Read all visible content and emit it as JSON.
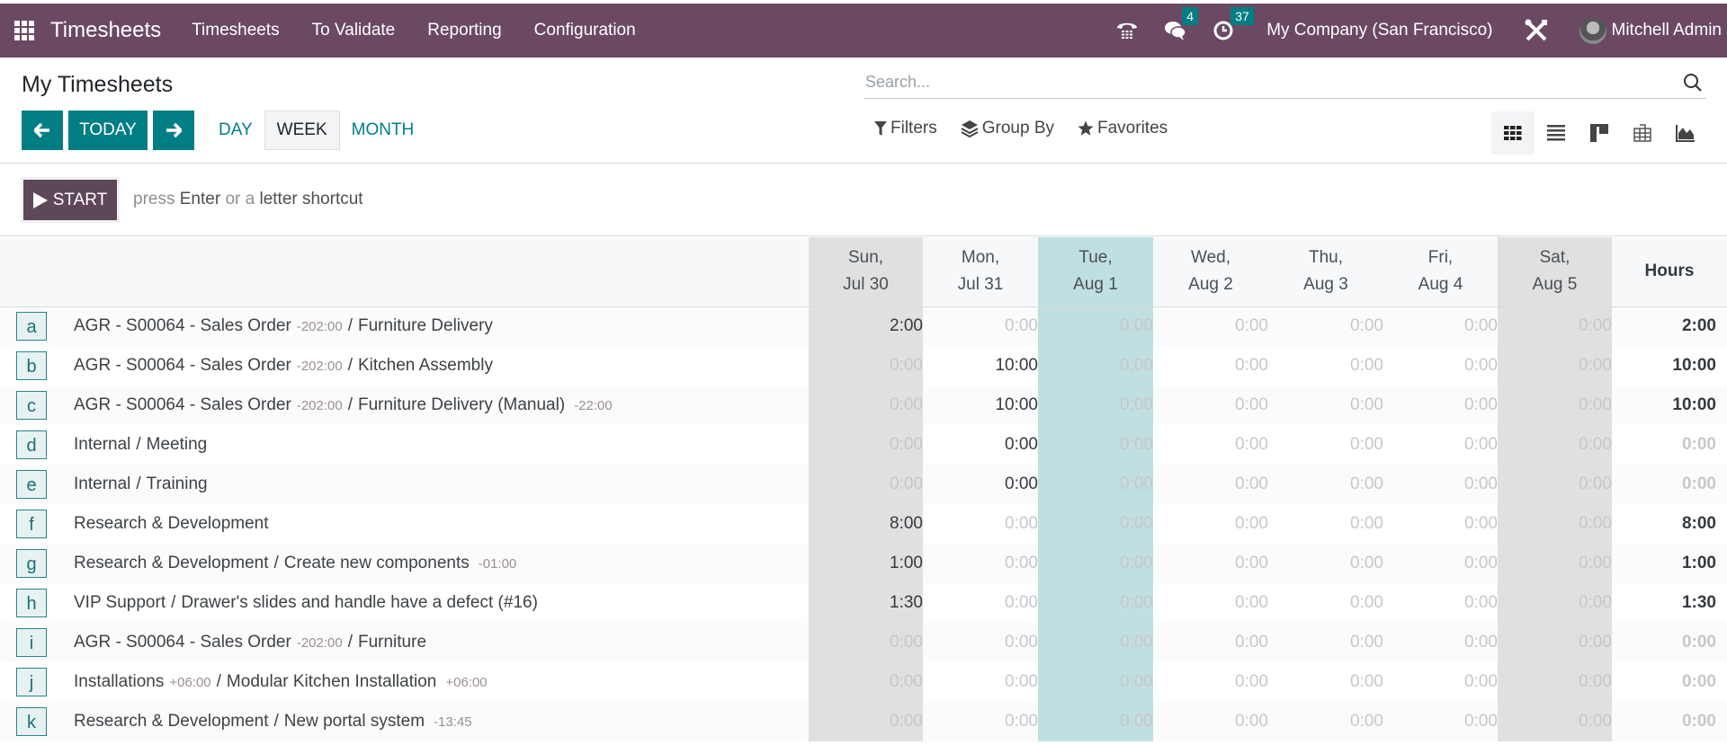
{
  "navbar": {
    "app_name": "Timesheets",
    "menu": [
      "Timesheets",
      "To Validate",
      "Reporting",
      "Configuration"
    ],
    "messages_count": "4",
    "activities_count": "37",
    "company": "My Company (San Francisco)",
    "user": "Mitchell Admin"
  },
  "control_panel": {
    "title": "My Timesheets",
    "today_label": "TODAY",
    "scales": [
      "DAY",
      "WEEK",
      "MONTH"
    ],
    "active_scale": "WEEK",
    "search_placeholder": "Search...",
    "filters_label": "Filters",
    "groupby_label": "Group By",
    "favorites_label": "Favorites",
    "views": [
      "grid-view",
      "list-view",
      "kanban-view",
      "pivot-view",
      "graph-view"
    ],
    "active_view": "grid-view"
  },
  "start_bar": {
    "start_label": "START",
    "hint_press": "press",
    "hint_enter": "Enter",
    "hint_or": "or a",
    "hint_shortcut": "letter shortcut"
  },
  "colors": {
    "navbar": "#6b4963",
    "primary": "#017e84",
    "start_button": "#5e4758",
    "today_column": "#c0dfe0",
    "weekend_column": "#e0e0e0"
  },
  "grid": {
    "days": [
      {
        "day": "Sun,",
        "date": "Jul 30",
        "type": "weekend"
      },
      {
        "day": "Mon,",
        "date": "Jul 31",
        "type": "normal"
      },
      {
        "day": "Tue,",
        "date": "Aug 1",
        "type": "today"
      },
      {
        "day": "Wed,",
        "date": "Aug 2",
        "type": "normal"
      },
      {
        "day": "Thu,",
        "date": "Aug 3",
        "type": "normal"
      },
      {
        "day": "Fri,",
        "date": "Aug 4",
        "type": "normal"
      },
      {
        "day": "Sat,",
        "date": "Aug 5",
        "type": "weekend"
      }
    ],
    "total_header": "Hours",
    "rows": [
      {
        "key": "a",
        "project": "AGR - S00064 - Sales Order",
        "project_remaining": "-202:00",
        "task": "Furniture Delivery",
        "task_remaining": "",
        "values": [
          "2:00",
          "0:00",
          "0:00",
          "0:00",
          "0:00",
          "0:00",
          "0:00"
        ],
        "set": [
          true,
          false,
          false,
          false,
          false,
          false,
          false
        ],
        "total": "2:00"
      },
      {
        "key": "b",
        "project": "AGR - S00064 - Sales Order",
        "project_remaining": "-202:00",
        "task": "Kitchen Assembly",
        "task_remaining": "",
        "values": [
          "0:00",
          "10:00",
          "0:00",
          "0:00",
          "0:00",
          "0:00",
          "0:00"
        ],
        "set": [
          false,
          true,
          false,
          false,
          false,
          false,
          false
        ],
        "total": "10:00"
      },
      {
        "key": "c",
        "project": "AGR - S00064 - Sales Order",
        "project_remaining": "-202:00",
        "task": "Furniture Delivery (Manual)",
        "task_remaining": "-22:00",
        "values": [
          "0:00",
          "10:00",
          "0:00",
          "0:00",
          "0:00",
          "0:00",
          "0:00"
        ],
        "set": [
          false,
          true,
          false,
          false,
          false,
          false,
          false
        ],
        "total": "10:00"
      },
      {
        "key": "d",
        "project": "Internal",
        "project_remaining": "",
        "task": "Meeting",
        "task_remaining": "",
        "values": [
          "0:00",
          "0:00",
          "0:00",
          "0:00",
          "0:00",
          "0:00",
          "0:00"
        ],
        "set": [
          false,
          true,
          false,
          false,
          false,
          false,
          false
        ],
        "total": "0:00"
      },
      {
        "key": "e",
        "project": "Internal",
        "project_remaining": "",
        "task": "Training",
        "task_remaining": "",
        "values": [
          "0:00",
          "0:00",
          "0:00",
          "0:00",
          "0:00",
          "0:00",
          "0:00"
        ],
        "set": [
          false,
          true,
          false,
          false,
          false,
          false,
          false
        ],
        "total": "0:00"
      },
      {
        "key": "f",
        "project": "Research & Development",
        "project_remaining": "",
        "task": "",
        "task_remaining": "",
        "values": [
          "8:00",
          "0:00",
          "0:00",
          "0:00",
          "0:00",
          "0:00",
          "0:00"
        ],
        "set": [
          true,
          false,
          false,
          false,
          false,
          false,
          false
        ],
        "total": "8:00"
      },
      {
        "key": "g",
        "project": "Research & Development",
        "project_remaining": "",
        "task": "Create new components",
        "task_remaining": "-01:00",
        "values": [
          "1:00",
          "0:00",
          "0:00",
          "0:00",
          "0:00",
          "0:00",
          "0:00"
        ],
        "set": [
          true,
          false,
          false,
          false,
          false,
          false,
          false
        ],
        "total": "1:00"
      },
      {
        "key": "h",
        "project": "VIP Support",
        "project_remaining": "",
        "task": "Drawer's slides and handle have a defect (#16)",
        "task_remaining": "",
        "values": [
          "1:30",
          "0:00",
          "0:00",
          "0:00",
          "0:00",
          "0:00",
          "0:00"
        ],
        "set": [
          true,
          false,
          false,
          false,
          false,
          false,
          false
        ],
        "total": "1:30"
      },
      {
        "key": "i",
        "project": "AGR - S00064 - Sales Order",
        "project_remaining": "-202:00",
        "task": "Furniture",
        "task_remaining": "",
        "values": [
          "0:00",
          "0:00",
          "0:00",
          "0:00",
          "0:00",
          "0:00",
          "0:00"
        ],
        "set": [
          false,
          false,
          false,
          false,
          false,
          false,
          false
        ],
        "total": "0:00"
      },
      {
        "key": "j",
        "project": "Installations",
        "project_remaining": "+06:00",
        "task": "Modular Kitchen Installation",
        "task_remaining": "+06:00",
        "values": [
          "0:00",
          "0:00",
          "0:00",
          "0:00",
          "0:00",
          "0:00",
          "0:00"
        ],
        "set": [
          false,
          false,
          false,
          false,
          false,
          false,
          false
        ],
        "total": "0:00"
      },
      {
        "key": "k",
        "project": "Research & Development",
        "project_remaining": "",
        "task": "New portal system",
        "task_remaining": "-13:45",
        "values": [
          "0:00",
          "0:00",
          "0:00",
          "0:00",
          "0:00",
          "0:00",
          "0:00"
        ],
        "set": [
          false,
          false,
          false,
          false,
          false,
          false,
          false
        ],
        "total": "0:00"
      }
    ]
  }
}
